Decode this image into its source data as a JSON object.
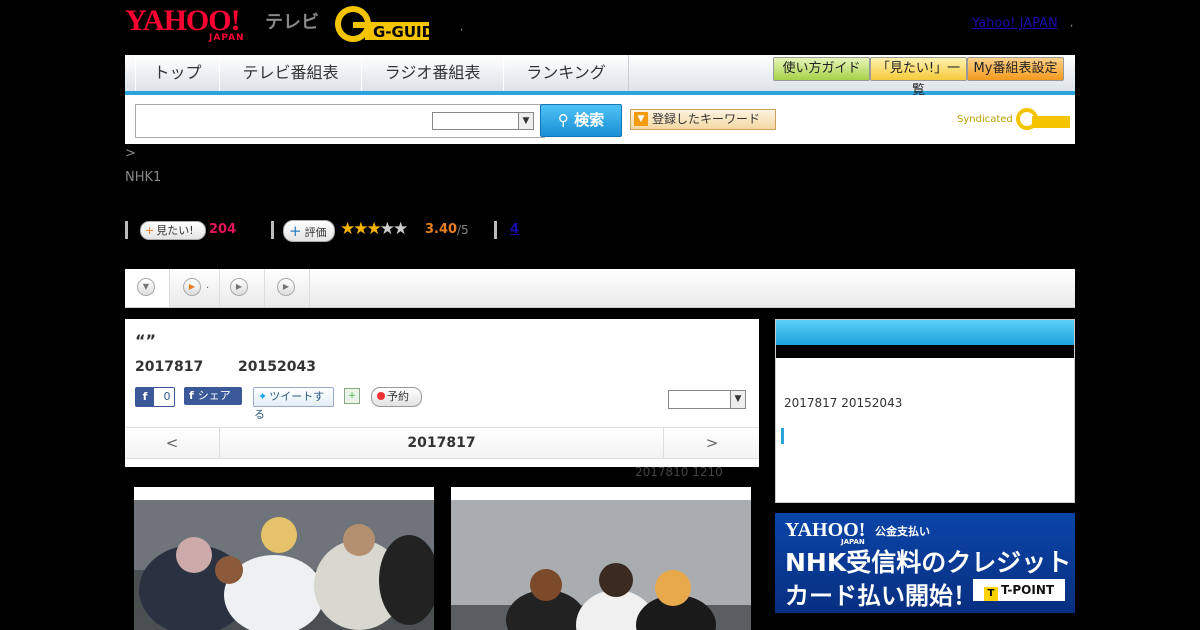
{
  "header": {
    "yahoo_logo": "YAHOO!",
    "yahoo_japan_sub": "JAPAN",
    "tv_label": "テレビ",
    "gguide_logo": "G-GUIDE",
    "dot": ",",
    "yahoo_japan_link": "Yahoo! JAPAN"
  },
  "nav": {
    "tabs": [
      "トップ",
      "テレビ番組表",
      "ラジオ番組表",
      "ランキング"
    ],
    "buttons": [
      "使い方ガイド",
      "「見たい!」一覧",
      "My番組表設定"
    ]
  },
  "search": {
    "input_value": "",
    "select_value": "",
    "button_label": "検索",
    "keywords_button": "登録したキーワード",
    "syndicated": "Syndicated"
  },
  "breadcrumb": ">",
  "channel": "NHK1",
  "stats": {
    "want_label": "見たい!",
    "want_count": "204",
    "rate_label": "評価",
    "rating": "3.40",
    "rating_max": "/5",
    "rating_value": 3.4,
    "review_count": "4"
  },
  "program_tabs": [
    ".",
    "",
    ""
  ],
  "program": {
    "title": "“”",
    "air_date": "2017817",
    "air_time": "20152043",
    "fb_like_count": "0",
    "fb_share": "シェア",
    "tweet": "ツイートする",
    "record": "予約",
    "select_value": "",
    "prev_day": "<",
    "current_day": "2017817",
    "next_day": ">",
    "updated": "2017810  1210"
  },
  "sidebar": {
    "dates": "2017817  20152043"
  },
  "banner": {
    "yahoo": "YAHOO!",
    "japan": "JAPAN",
    "public_pay": "公金支払い",
    "line1": "NHK受信料のクレジット",
    "line2": "カード払い開始！",
    "tpoint": "T-POINT",
    "tpoint_mark": "T"
  },
  "colors": {
    "accent_blue": "#2aa4dc",
    "yahoo_red": "#ff0033",
    "want_pink": "#e6155a",
    "rating_orange": "#e67e22",
    "banner_blue": "#0b45a8"
  }
}
